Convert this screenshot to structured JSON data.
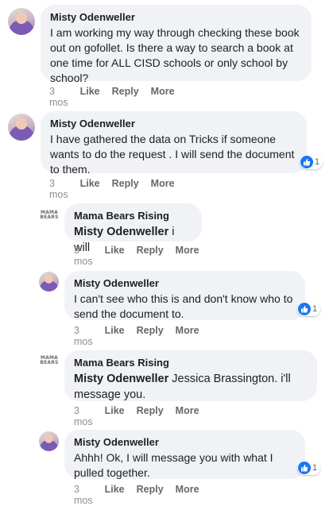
{
  "comments": [
    {
      "author": "Misty Odenweller",
      "text": "I am working my way through checking these book out on gofollet. Is there a way to search a book at one time for ALL CISD schools or only school by school?",
      "time": "3 mos",
      "like": "Like",
      "reply": "Reply",
      "more": "More"
    },
    {
      "author": "Misty Odenweller",
      "text": "I have gathered the data on Tricks if someone wants to do the request . I will send the document to them.",
      "time": "3 mos",
      "like": "Like",
      "reply": "Reply",
      "more": "More",
      "reaction_count": "1"
    }
  ],
  "replies": [
    {
      "author": "Mama Bears Rising",
      "mention": "Misty Odenweller",
      "text": " i will",
      "time": "3 mos",
      "like": "Like",
      "reply": "Reply",
      "more": "More"
    },
    {
      "author": "Misty Odenweller",
      "text": "I can't see who this is and don't know who to send the document to.",
      "time": "3 mos",
      "like": "Like",
      "reply": "Reply",
      "more": "More",
      "reaction_count": "1"
    },
    {
      "author": "Mama Bears Rising",
      "mention": "Misty Odenweller",
      "text": " Jessica Brassington. i'll message you.",
      "time": "3 mos",
      "like": "Like",
      "reply": "Reply",
      "more": "More"
    },
    {
      "author": "Misty Odenweller",
      "text": "Ahhh! Ok, I will message you with what I pulled together.",
      "time": "3 mos",
      "like": "Like",
      "reply": "Reply",
      "more": "More",
      "reaction_count": "1"
    }
  ],
  "logo": {
    "mama_bears_line1": "MAMA",
    "mama_bears_line2": "BEARS"
  },
  "colors": {
    "bubble": "#f0f2f5",
    "like_blue": "#1877f2",
    "meta_gray": "#65676b"
  }
}
